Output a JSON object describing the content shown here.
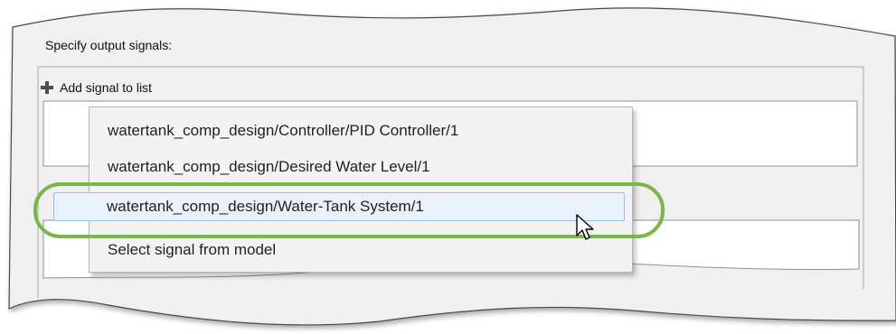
{
  "section": {
    "label": "Specify output signals:"
  },
  "add_button": {
    "label": "Add signal to list",
    "icon": "plus-icon"
  },
  "dropdown": {
    "items": [
      {
        "label": "watertank_comp_design/Controller/PID Controller/1",
        "selected": false
      },
      {
        "label": "watertank_comp_design/Desired  Water Level/1",
        "selected": false
      },
      {
        "label": "watertank_comp_design/Water-Tank System/1",
        "selected": true
      },
      {
        "label": "Select signal from model",
        "selected": false
      }
    ]
  },
  "highlight": {
    "color": "#7ab648"
  },
  "cursor": {
    "icon": "mouse-pointer-icon"
  }
}
